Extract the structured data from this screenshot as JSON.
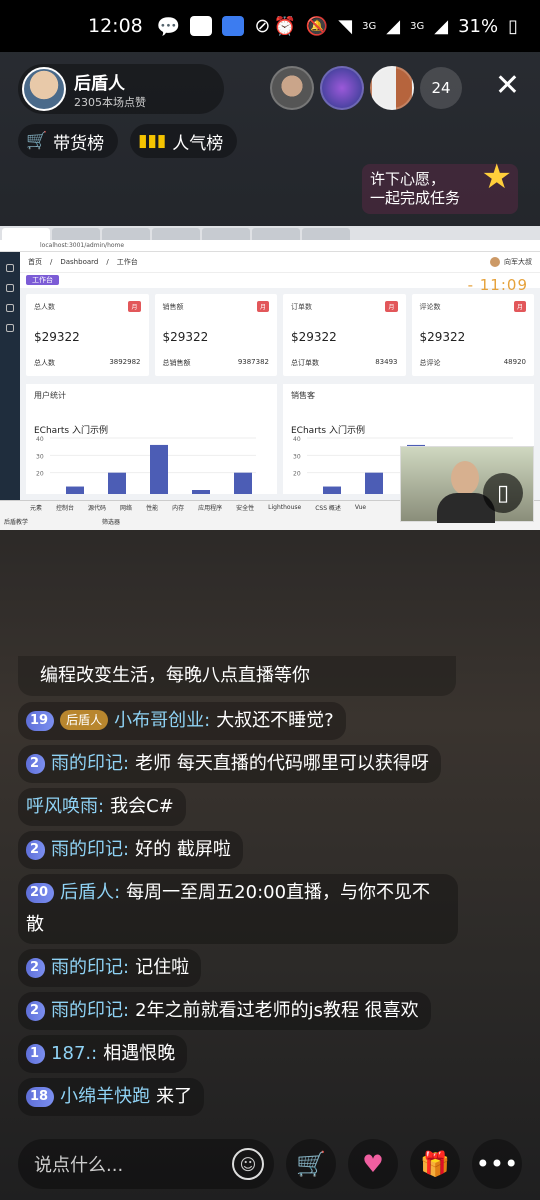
{
  "status": {
    "time": "12:08",
    "battery": "31%",
    "net1": "3G",
    "net2": "3G"
  },
  "host": {
    "name": "后盾人",
    "likes": "2305本场点赞"
  },
  "viewers": {
    "count": "24"
  },
  "chips": [
    {
      "icon": "cart-icon",
      "label": "带货榜"
    },
    {
      "icon": "chart-icon",
      "label": "人气榜"
    }
  ],
  "wish": {
    "line1": "许下心愿，",
    "line2": "一起完成任务"
  },
  "screen": {
    "address": "localhost:3001/admin/home",
    "breadcrumb": [
      "首页",
      "Dashboard",
      "工作台"
    ],
    "user": "向军大叔",
    "tag": "工作台",
    "clock": "- 11:09",
    "cards": [
      {
        "title": "总人数",
        "tag": "月",
        "value": "$29322",
        "foot_label": "总人数",
        "foot_value": "3892982"
      },
      {
        "title": "销售额",
        "tag": "月",
        "value": "$29322",
        "foot_label": "总销售额",
        "foot_value": "9387382"
      },
      {
        "title": "订单数",
        "tag": "月",
        "value": "$29322",
        "foot_label": "总订单数",
        "foot_value": "83493"
      },
      {
        "title": "评论数",
        "tag": "月",
        "value": "$29322",
        "foot_label": "总评论",
        "foot_value": "48920"
      }
    ],
    "charts": [
      {
        "header": "用户统计",
        "title": "ECharts 入门示例"
      },
      {
        "header": "销售客",
        "title": "ECharts 入门示例"
      }
    ],
    "devtools_tabs": [
      "元素",
      "控制台",
      "源代码",
      "网络",
      "性能",
      "内存",
      "应用程序",
      "安全性",
      "Lighthouse",
      "CSS 概述",
      "Vue"
    ],
    "devtools_filter": "筛选器",
    "devtools_ctx": "后盾教学"
  },
  "chart_data": [
    {
      "type": "bar",
      "title": "ECharts 入门示例",
      "yticks": [
        20,
        30,
        40
      ],
      "ylim": [
        10,
        40
      ],
      "values": [
        12,
        20,
        36,
        10,
        20
      ]
    },
    {
      "type": "bar",
      "title": "ECharts 入门示例",
      "yticks": [
        20,
        30,
        40
      ],
      "ylim": [
        10,
        40
      ],
      "values": [
        12,
        20,
        36,
        10,
        20
      ]
    }
  ],
  "pinned": "编程改变生活，每晚八点直播等你",
  "messages": [
    {
      "badge": "19",
      "fan": "后盾人",
      "nick": "小布哥创业:",
      "text": "大叔还不睡觉?"
    },
    {
      "badge": "2",
      "nick": "雨的印记:",
      "text": "老师 每天直播的代码哪里可以获得呀"
    },
    {
      "nick": "呼风唤雨:",
      "text": "我会C#"
    },
    {
      "badge": "2",
      "nick": "雨的印记:",
      "text": "好的 截屏啦"
    },
    {
      "badge": "20",
      "nick": "后盾人:",
      "text": "每周一至周五20:00直播，与你不见不散"
    },
    {
      "badge": "2",
      "nick": "雨的印记:",
      "text": "记住啦"
    },
    {
      "badge": "2",
      "nick": "雨的印记:",
      "text": "2年之前就看过老师的js教程 很喜欢"
    },
    {
      "badge": "1",
      "nick": "187.:",
      "text": "相遇恨晚"
    },
    {
      "badge": "18",
      "nick": "小绵羊快跑",
      "text": "来了"
    }
  ],
  "input": {
    "placeholder": "说点什么..."
  },
  "colors": {
    "accent": "#8fd2f4",
    "chip_icon": "#f5c400",
    "clock": "#e6a23c"
  }
}
